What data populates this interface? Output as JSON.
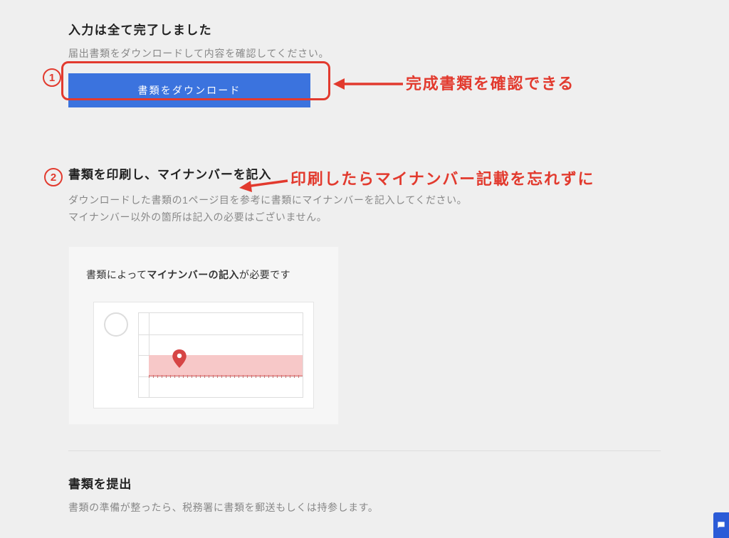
{
  "colors": {
    "accent_red": "#e23a2e",
    "button_blue": "#3b73de",
    "widget_blue": "#2b5bd7"
  },
  "section1": {
    "title": "入力は全て完了しました",
    "description": "届出書類をダウンロードして内容を確認してください。",
    "download_button_label": "書類をダウンロード"
  },
  "annotations": {
    "marker1": "1",
    "marker2": "2",
    "note1": "完成書類を確認できる",
    "note2": "印刷したらマイナンバー記載を忘れずに"
  },
  "section2": {
    "title": "書類を印刷し、マイナンバーを記入",
    "description_line1": "ダウンロードした書類の1ページ目を参考に書類にマイナンバーを記入してください。",
    "description_line2": "マイナンバー以外の箇所は記入の必要はございません。",
    "infobox_prefix": "書類によって",
    "infobox_strong": "マイナンバーの記入",
    "infobox_suffix": "が必要です"
  },
  "section3": {
    "title": "書類を提出",
    "description": "書類の準備が整ったら、税務署に書類を郵送もしくは持参します。"
  }
}
